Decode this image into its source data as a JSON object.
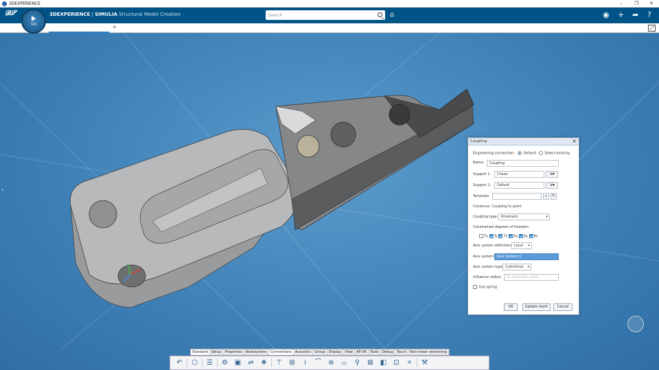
{
  "window": {
    "title": "3DEXPERIENCE",
    "controls": [
      "–",
      "❐",
      "✕"
    ]
  },
  "header": {
    "brand_bold": "3DEXPERIENCE",
    "brand_sep": " | ",
    "brand_simulia": "SIMULIA",
    "app_name": " Structural Model Creation",
    "compass_version": "V.R",
    "search_placeholder": "Search"
  },
  "tabs": {
    "add": "+"
  },
  "dialog": {
    "title": "Coupling",
    "engineering_connection_label": "Engineering connection:",
    "option_default": "Default",
    "option_select_existing": "Select existing",
    "name_label": "Name:",
    "name_value": "Coupling",
    "support1_label": "Support 1:",
    "support1_value": "Chase",
    "support2_label": "Support 2:",
    "support2_value": "Default",
    "template_label": "Template:",
    "construct_label": "Construct:",
    "construct_value": "Coupling to point",
    "coupling_type_label": "Coupling type:",
    "coupling_type_value": "Kinematic",
    "constrained_dof_label": "Constrained degrees of freedom",
    "dofs": [
      {
        "label": "Tx",
        "checked": false
      },
      {
        "label": "Ty",
        "checked": true
      },
      {
        "label": "Tz",
        "checked": true
      },
      {
        "label": "Rx",
        "checked": true
      },
      {
        "label": "Ry",
        "checked": true
      },
      {
        "label": "Rz",
        "checked": true
      }
    ],
    "axis_definition_label": "Axis system definition:",
    "axis_definition_value": "Local",
    "axis_system_label": "Axis system:",
    "axis_system_value": "Axis System.1",
    "axis_system_type_label": "Axis system type:",
    "axis_system_type_value": "Cylindrical",
    "influence_radius_label": "Influence radius:",
    "influence_radius_placeholder": "To automatic point",
    "use_spring_label": "Use spring",
    "ok": "OK",
    "update_mesh": "Update mesh",
    "cancel": "Cancel"
  },
  "bottom_tabs": [
    "Standard",
    "Setup",
    "Properties",
    "Abstractions",
    "Connections",
    "Acoustics",
    "Group",
    "Display",
    "View",
    "AR-VR",
    "Tools",
    "Debug",
    "Touch",
    "Non-linear versioning"
  ],
  "active_bottom_tab": "Connections",
  "colors": {
    "header": "#005386",
    "viewport": "#4a8dc4",
    "selection": "#5a9ad6"
  }
}
